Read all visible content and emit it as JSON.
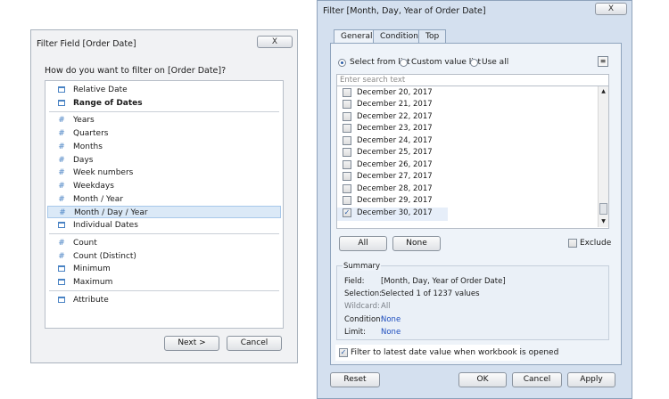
{
  "left_dialog": {
    "title": "Filter Field [Order Date]",
    "close_glyph": "X",
    "prompt": "How do you want to filter on [Order Date]?",
    "items": [
      {
        "label": "Relative Date",
        "icon": "calendar-icon"
      },
      {
        "label": "Range of Dates",
        "icon": "calendar-icon"
      },
      {
        "label": "Years",
        "icon": "hash-icon"
      },
      {
        "label": "Quarters",
        "icon": "hash-icon"
      },
      {
        "label": "Months",
        "icon": "hash-icon"
      },
      {
        "label": "Days",
        "icon": "hash-icon"
      },
      {
        "label": "Week numbers",
        "icon": "hash-icon"
      },
      {
        "label": "Weekdays",
        "icon": "hash-icon"
      },
      {
        "label": "Month / Year",
        "icon": "hash-icon"
      },
      {
        "label": "Month / Day / Year",
        "icon": "hash-icon"
      },
      {
        "label": "Individual Dates",
        "icon": "calendar-icon"
      },
      {
        "label": "Count",
        "icon": "hash-icon"
      },
      {
        "label": "Count (Distinct)",
        "icon": "hash-icon"
      },
      {
        "label": "Minimum",
        "icon": "calendar-icon"
      },
      {
        "label": "Maximum",
        "icon": "calendar-icon"
      },
      {
        "label": "Attribute",
        "icon": "calendar-icon"
      }
    ],
    "next_label": "Next >",
    "cancel_label": "Cancel"
  },
  "right_dialog": {
    "title": "Filter [Month, Day, Year of Order Date]",
    "close_glyph": "X",
    "tabs": [
      "General",
      "Condition",
      "Top"
    ],
    "radio_options": [
      "Select from list",
      "Custom value list",
      "Use all"
    ],
    "menu_glyph": "≡",
    "search_placeholder": "Enter search text",
    "dates": [
      {
        "label": "December 20, 2017",
        "checked": false
      },
      {
        "label": "December 21, 2017",
        "checked": false
      },
      {
        "label": "December 22, 2017",
        "checked": false
      },
      {
        "label": "December 23, 2017",
        "checked": false
      },
      {
        "label": "December 24, 2017",
        "checked": false
      },
      {
        "label": "December 25, 2017",
        "checked": false
      },
      {
        "label": "December 26, 2017",
        "checked": false
      },
      {
        "label": "December 27, 2017",
        "checked": false
      },
      {
        "label": "December 28, 2017",
        "checked": false
      },
      {
        "label": "December 29, 2017",
        "checked": false
      },
      {
        "label": "December 30, 2017",
        "checked": true
      }
    ],
    "check_glyph": "✓",
    "scroll_up_glyph": "▲",
    "scroll_down_glyph": "▼",
    "all_label": "All",
    "none_label": "None",
    "exclude_label": "Exclude",
    "summary": {
      "title": "Summary",
      "field_label": "Field:",
      "field_value": "[Month, Day, Year of Order Date]",
      "selection_label": "Selection:",
      "selection_value": "Selected 1 of 1237 values",
      "wildcard_label": "Wildcard:",
      "wildcard_value": "All",
      "condition_label": "Condition:",
      "condition_value": "None",
      "limit_label": "Limit:",
      "limit_value": "None"
    },
    "latest_label": "Filter to latest date value when workbook is opened",
    "reset_label": "Reset",
    "ok_label": "OK",
    "cancel_label": "Cancel",
    "apply_label": "Apply"
  }
}
